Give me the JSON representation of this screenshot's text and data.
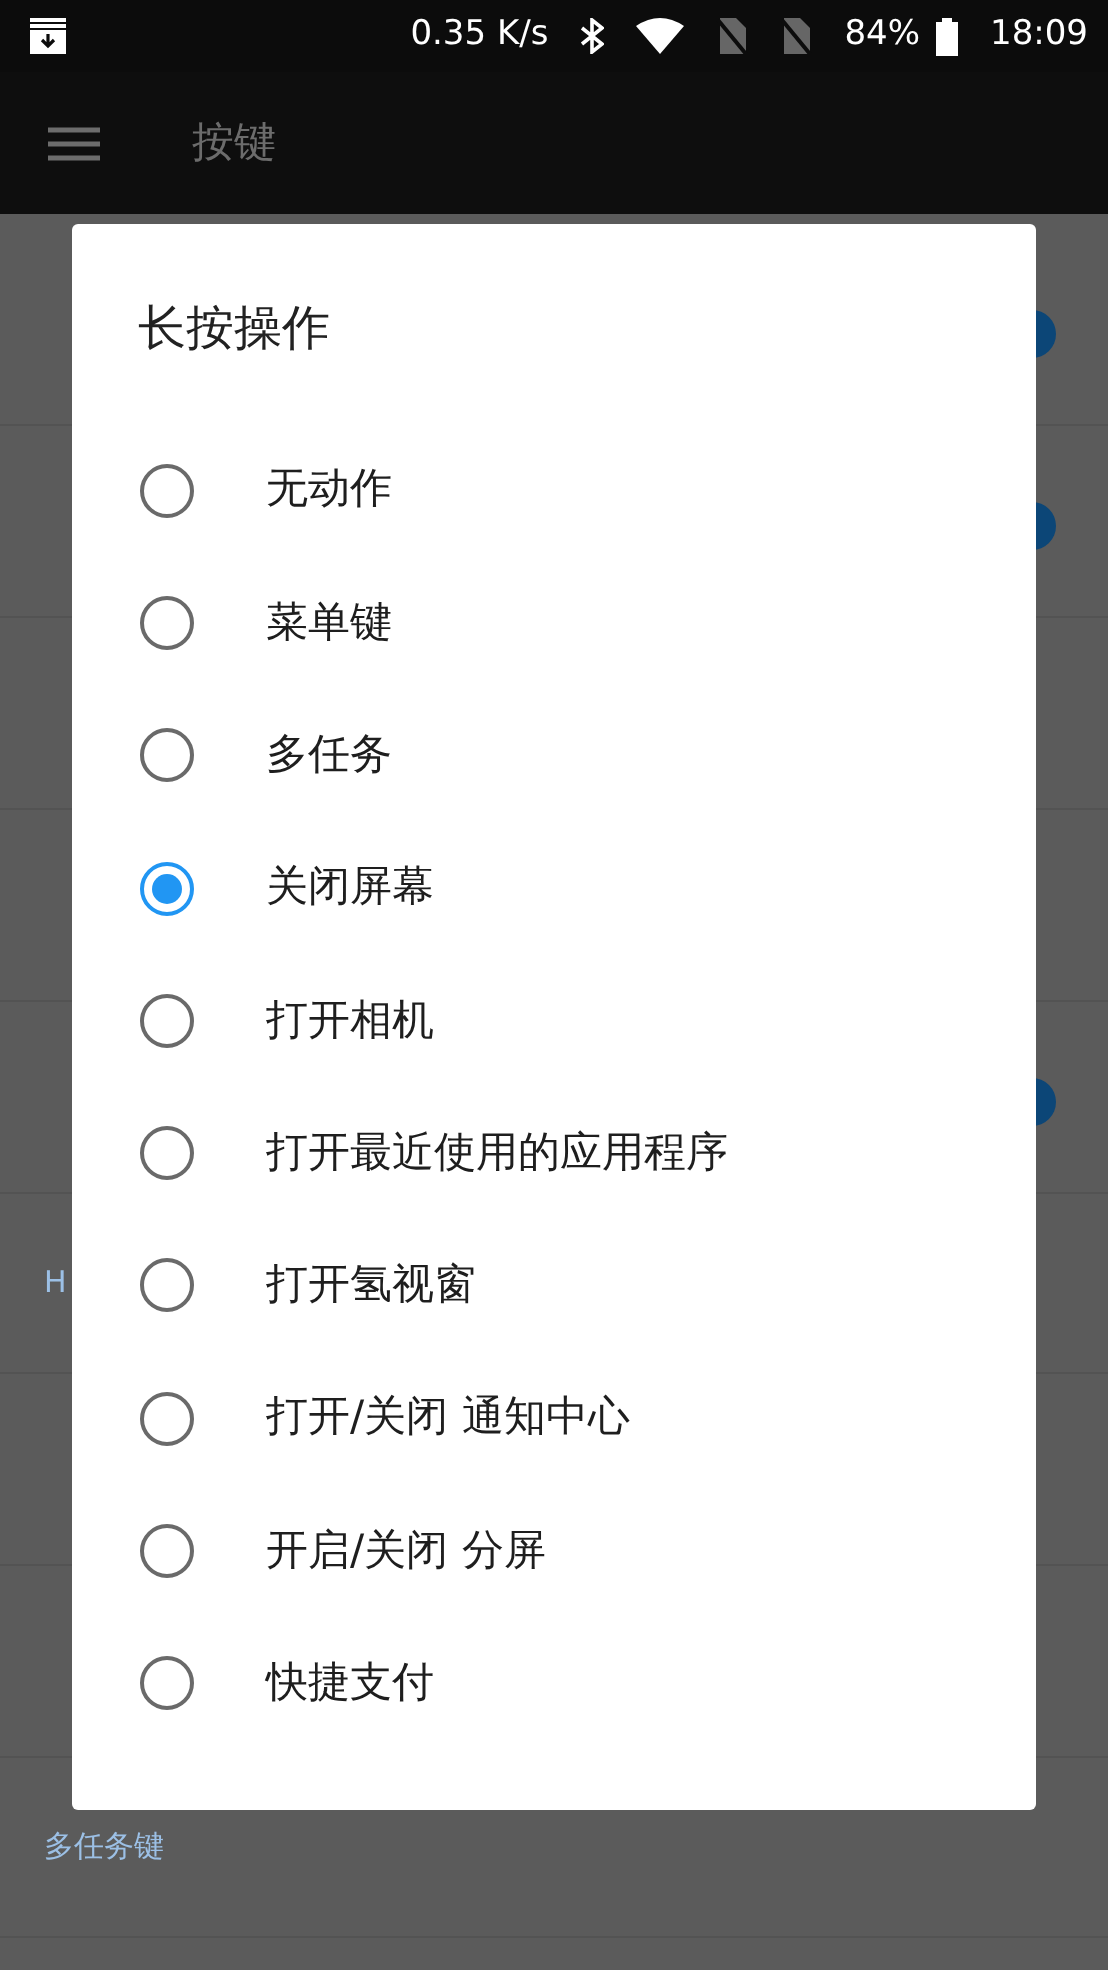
{
  "status_bar": {
    "speed": "0.35 K/s",
    "battery": "84%",
    "time": "18:09"
  },
  "app_bar": {
    "title": "按键"
  },
  "settings": [
    {
      "kind": "row",
      "on": true
    },
    {
      "kind": "row",
      "on": true
    },
    {
      "kind": "row",
      "on": false
    },
    {
      "kind": "row",
      "on": false
    },
    {
      "kind": "row",
      "on": true
    },
    {
      "kind": "header",
      "title": "H"
    },
    {
      "kind": "row",
      "on": false
    },
    {
      "kind": "row",
      "on": false
    },
    {
      "kind": "header",
      "title": "多任务键"
    }
  ],
  "dialog": {
    "title": "长按操作",
    "options": [
      {
        "label": "无动作",
        "selected": false
      },
      {
        "label": "菜单键",
        "selected": false
      },
      {
        "label": "多任务",
        "selected": false
      },
      {
        "label": "关闭屏幕",
        "selected": true
      },
      {
        "label": "打开相机",
        "selected": false
      },
      {
        "label": "打开最近使用的应用程序",
        "selected": false
      },
      {
        "label": "打开氢视窗",
        "selected": false
      },
      {
        "label": "打开/关闭 通知中心",
        "selected": false
      },
      {
        "label": "开启/关闭 分屏",
        "selected": false
      },
      {
        "label": "快捷支付",
        "selected": false
      }
    ]
  }
}
